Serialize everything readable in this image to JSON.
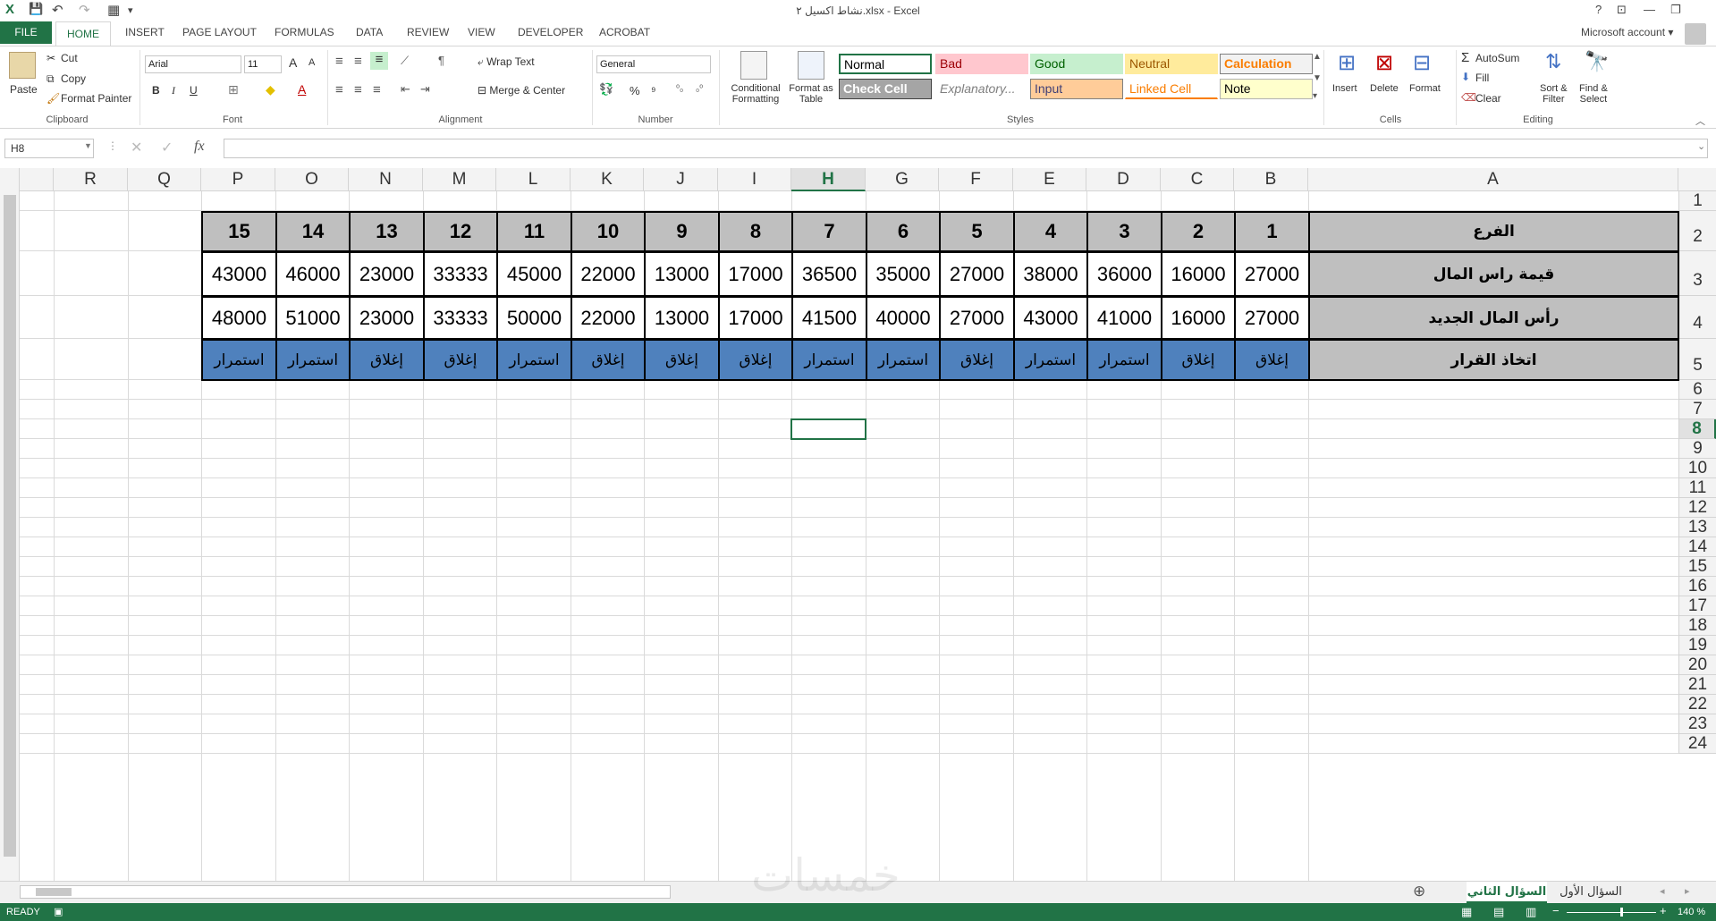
{
  "window": {
    "title": "نشاط اكسيل ٢.xlsx - Excel",
    "help_glyph": "?",
    "ribbon_options_glyph": "⊡",
    "minimize_glyph": "—",
    "restore_glyph": "❐"
  },
  "quick_access": {
    "excel_icon": "X",
    "save_icon": "💾",
    "undo_icon": "↶",
    "redo_icon": "↷",
    "form_icon": "▦",
    "customize_icon": "▾"
  },
  "tabs": {
    "file": "FILE",
    "items": [
      "HOME",
      "INSERT",
      "PAGE LAYOUT",
      "FORMULAS",
      "DATA",
      "REVIEW",
      "VIEW",
      "DEVELOPER",
      "ACROBAT"
    ]
  },
  "account": {
    "label": "Microsoft account",
    "caret": "▾"
  },
  "ribbon": {
    "clipboard": {
      "paste": "Paste",
      "cut": "Cut",
      "copy": "Copy",
      "format_painter": "Format Painter",
      "group": "Clipboard"
    },
    "font": {
      "name": "Arial",
      "size": "11",
      "bold": "B",
      "italic": "I",
      "underline": "U",
      "grow": "A",
      "shrink": "A",
      "group": "Font"
    },
    "alignment": {
      "wrap_text": "Wrap Text",
      "merge_center": "Merge & Center",
      "group": "Alignment"
    },
    "number": {
      "format": "General",
      "percent": "%",
      "comma": "⁹",
      "group": "Number"
    },
    "styles": {
      "conditional_formatting": [
        "Conditional",
        "Formatting"
      ],
      "format_as_table": [
        "Format as",
        "Table"
      ],
      "gallery": [
        {
          "label": "Normal",
          "bg": "#ffffff",
          "fg": "#000000",
          "border": "#217346"
        },
        {
          "label": "Bad",
          "bg": "#ffc7ce",
          "fg": "#9c0006",
          "border": "#ffc7ce"
        },
        {
          "label": "Good",
          "bg": "#c6efce",
          "fg": "#006100",
          "border": "#c6efce"
        },
        {
          "label": "Neutral",
          "bg": "#ffeb9c",
          "fg": "#9c5700",
          "border": "#ffeb9c"
        },
        {
          "label": "Calculation",
          "bg": "#f2f2f2",
          "fg": "#fa7d00",
          "border": "#7f7f7f"
        },
        {
          "label": "Check Cell",
          "bg": "#a5a5a5",
          "fg": "#ffffff",
          "border": "#3f3f3f"
        },
        {
          "label": "Explanatory...",
          "bg": "#ffffff",
          "fg": "#7f7f7f",
          "border": "#ffffff"
        },
        {
          "label": "Input",
          "bg": "#ffcc99",
          "fg": "#3f3f76",
          "border": "#7f7f7f"
        },
        {
          "label": "Linked Cell",
          "bg": "#ffffff",
          "fg": "#fa7d00",
          "border": "#ffffff"
        },
        {
          "label": "Note",
          "bg": "#ffffcc",
          "fg": "#000000",
          "border": "#b2b2b2"
        }
      ],
      "group": "Styles"
    },
    "cells": {
      "insert": "Insert",
      "delete": "Delete",
      "format": "Format",
      "group": "Cells"
    },
    "editing": {
      "autosum": "AutoSum",
      "fill": "Fill",
      "clear": "Clear",
      "sort_filter": [
        "Sort &",
        "Filter"
      ],
      "find_select": [
        "Find &",
        "Select"
      ],
      "group": "Editing"
    }
  },
  "formula_bar": {
    "name_box": "H8",
    "fx": "fx",
    "cancel": "✕",
    "enter": "✓",
    "formula": ""
  },
  "grid": {
    "columns": [
      "R",
      "Q",
      "P",
      "O",
      "N",
      "M",
      "L",
      "K",
      "J",
      "I",
      "H",
      "G",
      "F",
      "E",
      "D",
      "C",
      "B",
      "A"
    ],
    "selected_column": "H",
    "rows": [
      "1",
      "2",
      "3",
      "4",
      "5",
      "6",
      "7",
      "8",
      "9",
      "10",
      "11",
      "12",
      "13",
      "14",
      "15",
      "16",
      "17",
      "18",
      "19",
      "20",
      "21",
      "22",
      "23",
      "24"
    ],
    "selected_row": "8"
  },
  "table": {
    "branch_label": "الفرع",
    "capital_label": "قيمة راس المال",
    "new_capital_label": "رأس المال الجديد",
    "decision_label": "اتخاذ القرار",
    "branches": [
      "1",
      "2",
      "3",
      "4",
      "5",
      "6",
      "7",
      "8",
      "9",
      "10",
      "11",
      "12",
      "13",
      "14",
      "15"
    ],
    "capital": [
      "27000",
      "16000",
      "36000",
      "38000",
      "27000",
      "35000",
      "36500",
      "17000",
      "13000",
      "22000",
      "45000",
      "33333",
      "23000",
      "46000",
      "43000"
    ],
    "new_capital": [
      "27000",
      "16000",
      "41000",
      "43000",
      "27000",
      "40000",
      "41500",
      "17000",
      "13000",
      "22000",
      "50000",
      "33333",
      "23000",
      "51000",
      "48000"
    ],
    "decision": [
      "إغلاق",
      "إغلاق",
      "استمرار",
      "استمرار",
      "إغلاق",
      "استمرار",
      "استمرار",
      "إغلاق",
      "إغلاق",
      "إغلاق",
      "استمرار",
      "إغلاق",
      "إغلاق",
      "استمرار",
      "استمرار"
    ]
  },
  "sheets": {
    "items": [
      "السؤال الثاني",
      "السؤال الأول"
    ],
    "active": "السؤال الثاني",
    "add": "⊕"
  },
  "status": {
    "ready": "READY",
    "zoom": "140 %"
  },
  "watermark": "خمسات"
}
